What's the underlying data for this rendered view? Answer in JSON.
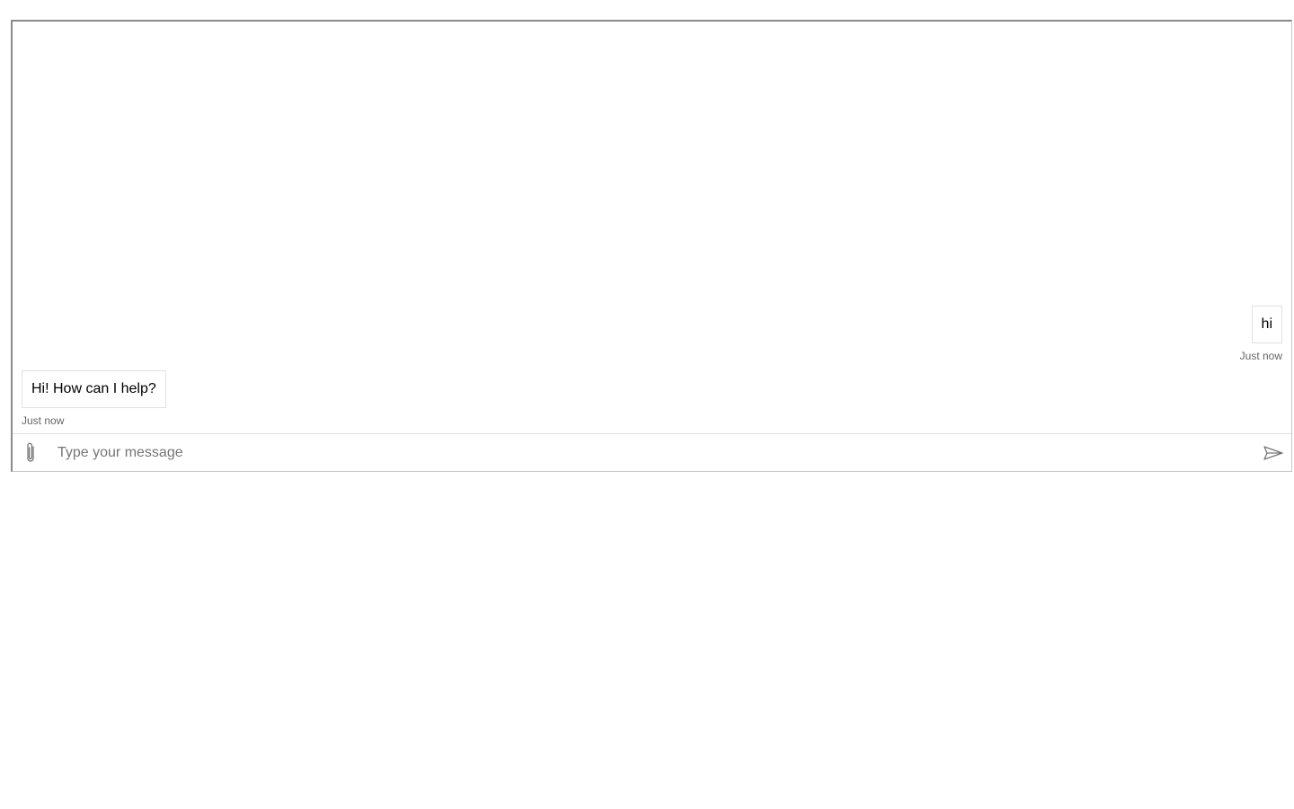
{
  "transcript": {
    "messages": [
      {
        "from": "user",
        "text": "hi",
        "timestamp": "Just now"
      },
      {
        "from": "bot",
        "text": "Hi! How can I help?",
        "timestamp": "Just now"
      }
    ]
  },
  "composer": {
    "placeholder": "Type your message",
    "value": "",
    "attach_icon": "paperclip-icon",
    "send_icon": "send-icon"
  },
  "colors": {
    "border": "#e1e1e1",
    "frame_border": "#8a8a8a",
    "timestamp": "#666666",
    "placeholder": "#767676",
    "icon": "#767676"
  }
}
